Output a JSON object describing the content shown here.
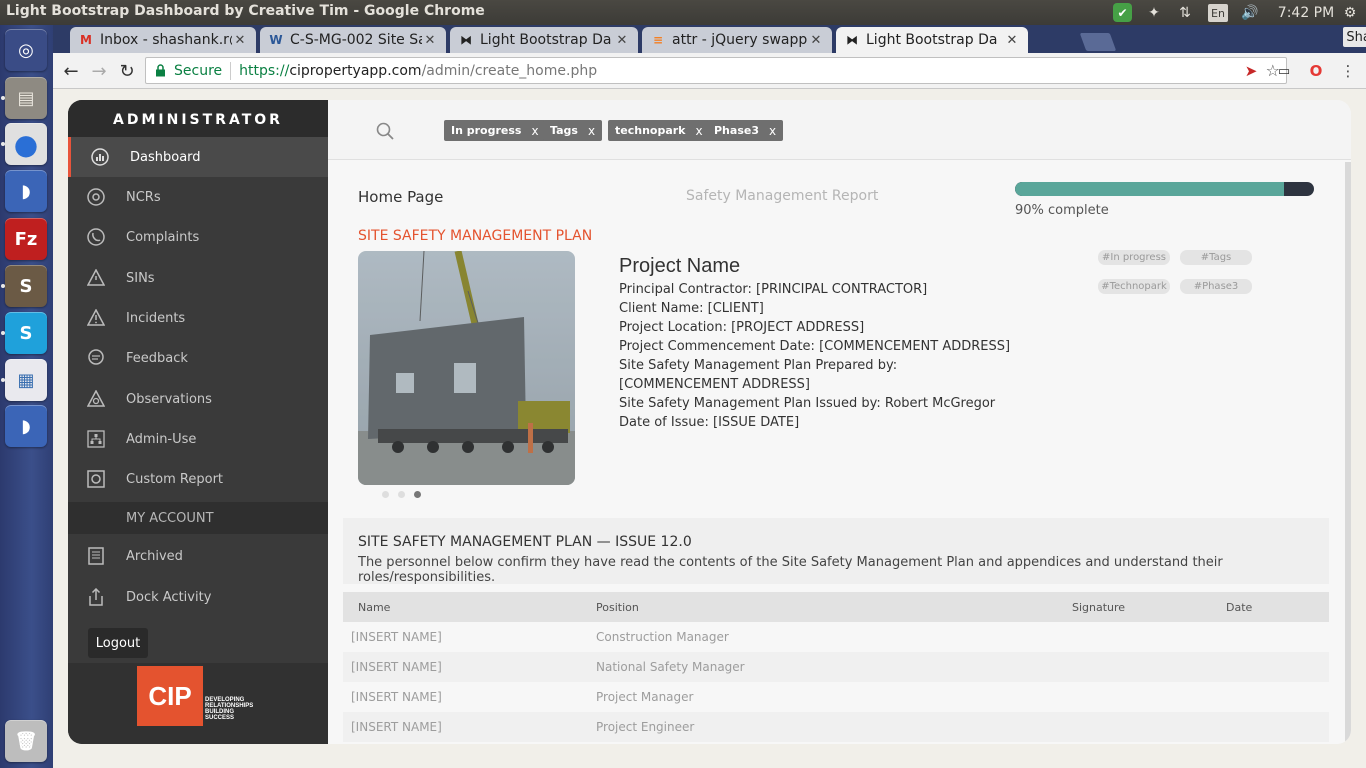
{
  "os": {
    "window_title": "Light Bootstrap Dashboard by Creative Tim - Google Chrome",
    "keyboard_layout": "En",
    "clock": "7:42 PM"
  },
  "launcher": {
    "items": [
      {
        "name": "ubuntu-dash",
        "glyph": "◎",
        "color": "#3a4c86"
      },
      {
        "name": "files",
        "glyph": "▤",
        "color": "#8e8a82"
      },
      {
        "name": "chrome",
        "glyph": "●",
        "color": "#e0e0e0"
      },
      {
        "name": "dolphin",
        "glyph": "◗",
        "color": "#3b65b7"
      },
      {
        "name": "filezilla",
        "glyph": "Fz",
        "color": "#bf1f1f"
      },
      {
        "name": "sublime-text",
        "glyph": "S",
        "color": "#6b5a45"
      },
      {
        "name": "skype",
        "glyph": "S",
        "color": "#1fa1db"
      },
      {
        "name": "document-viewer",
        "glyph": "▦",
        "color": "#e9e9ee"
      },
      {
        "name": "dolphin-2",
        "glyph": "◗",
        "color": "#3b65b7"
      },
      {
        "name": "trash",
        "glyph": "🗑",
        "color": "#bdbdbd"
      }
    ]
  },
  "browser": {
    "tabs": [
      {
        "title": "Inbox - shashank.r@",
        "favicon": "M",
        "favicon_color": "#d93025",
        "active": false
      },
      {
        "title": "C-S-MG-002 Site Saf",
        "favicon": "W",
        "favicon_color": "#2b5797",
        "active": false
      },
      {
        "title": "Light Bootstrap Da",
        "favicon": "⧓",
        "favicon_color": "#222222",
        "active": false
      },
      {
        "title": "attr - jQuery swapp",
        "favicon": "≡",
        "favicon_color": "#f48024",
        "active": false
      },
      {
        "title": "Light Bootstrap Da",
        "favicon": "⧓",
        "favicon_color": "#222222",
        "active": true
      }
    ],
    "profile_name": "Shashank",
    "secure_label": "Secure",
    "url_scheme": "https://",
    "url_host": "cipropertyapp.com",
    "url_path": "/admin/create_home.php"
  },
  "sidebar": {
    "brand": "ADMINISTRATOR",
    "items": [
      {
        "label": "Dashboard",
        "icon": "dashboard-icon",
        "active": true
      },
      {
        "label": "NCRs",
        "icon": "ncr-icon",
        "active": false
      },
      {
        "label": "Complaints",
        "icon": "phone-icon",
        "active": false
      },
      {
        "label": "SINs",
        "icon": "warning-icon",
        "active": false
      },
      {
        "label": "Incidents",
        "icon": "alert-icon",
        "active": false
      },
      {
        "label": "Feedback",
        "icon": "chat-icon",
        "active": false
      },
      {
        "label": "Observations",
        "icon": "eye-icon",
        "active": false
      },
      {
        "label": "Admin-Use",
        "icon": "org-chart-icon",
        "active": false
      },
      {
        "label": "Custom Report",
        "icon": "report-icon",
        "active": false
      }
    ],
    "account_header": "MY ACCOUNT",
    "account_items": [
      {
        "label": "Archived",
        "icon": "archive-icon"
      },
      {
        "label": "Dock Activity",
        "icon": "upload-icon"
      }
    ],
    "logout_label": "Logout",
    "logo_text": "CIP",
    "logo_tagline": [
      "DEVELOPING",
      "RELATIONSHIPS",
      "BUILDING",
      "SUCCESS"
    ]
  },
  "filter_tags": [
    "In progress",
    "Tags",
    "technopark",
    "Phase3"
  ],
  "page": {
    "home_title": "Home Page",
    "report_title": "Safety Management Report",
    "progress_percent": 90,
    "progress_label": "90% complete",
    "plan_heading": "SITE SAFETY MANAGEMENT PLAN",
    "project_name": "Project Name",
    "details": [
      "Principal Contractor: [PRINCIPAL CONTRACTOR]",
      "Client Name: [CLIENT]",
      "Project Location: [PROJECT ADDRESS]",
      "Project Commencement Date: [COMMENCEMENT ADDRESS]",
      "Site Safety Management Plan Prepared by: [COMMENCEMENT ADDRESS]",
      "Site Safety Management Plan Issued by: Robert McGregor",
      "Date of Issue: [ISSUE DATE]"
    ],
    "hash_tags": [
      "#In progress",
      "#Tags",
      "#Technopark",
      "#Phase3"
    ],
    "carousel_active": 3,
    "carousel_count": 3,
    "issue_title": "SITE SAFETY MANAGEMENT PLAN — ISSUE 12.0",
    "issue_desc": "The personnel below confirm they have read the contents of the Site Safety Management Plan and appendices and understand their roles/responsibilities.",
    "table": {
      "headers": [
        "Name",
        "Position",
        "Signature",
        "Date"
      ],
      "rows": [
        [
          "[INSERT NAME]",
          "Construction Manager",
          "",
          ""
        ],
        [
          "[INSERT NAME]",
          "National Safety Manager",
          "",
          ""
        ],
        [
          "[INSERT NAME]",
          "Project Manager",
          "",
          ""
        ],
        [
          "[INSERT NAME]",
          "Project Engineer",
          "",
          ""
        ]
      ]
    }
  },
  "colors": {
    "accent": "#e4532f",
    "progress": "#5aa69a",
    "sidebar": "#3a3a3a"
  }
}
